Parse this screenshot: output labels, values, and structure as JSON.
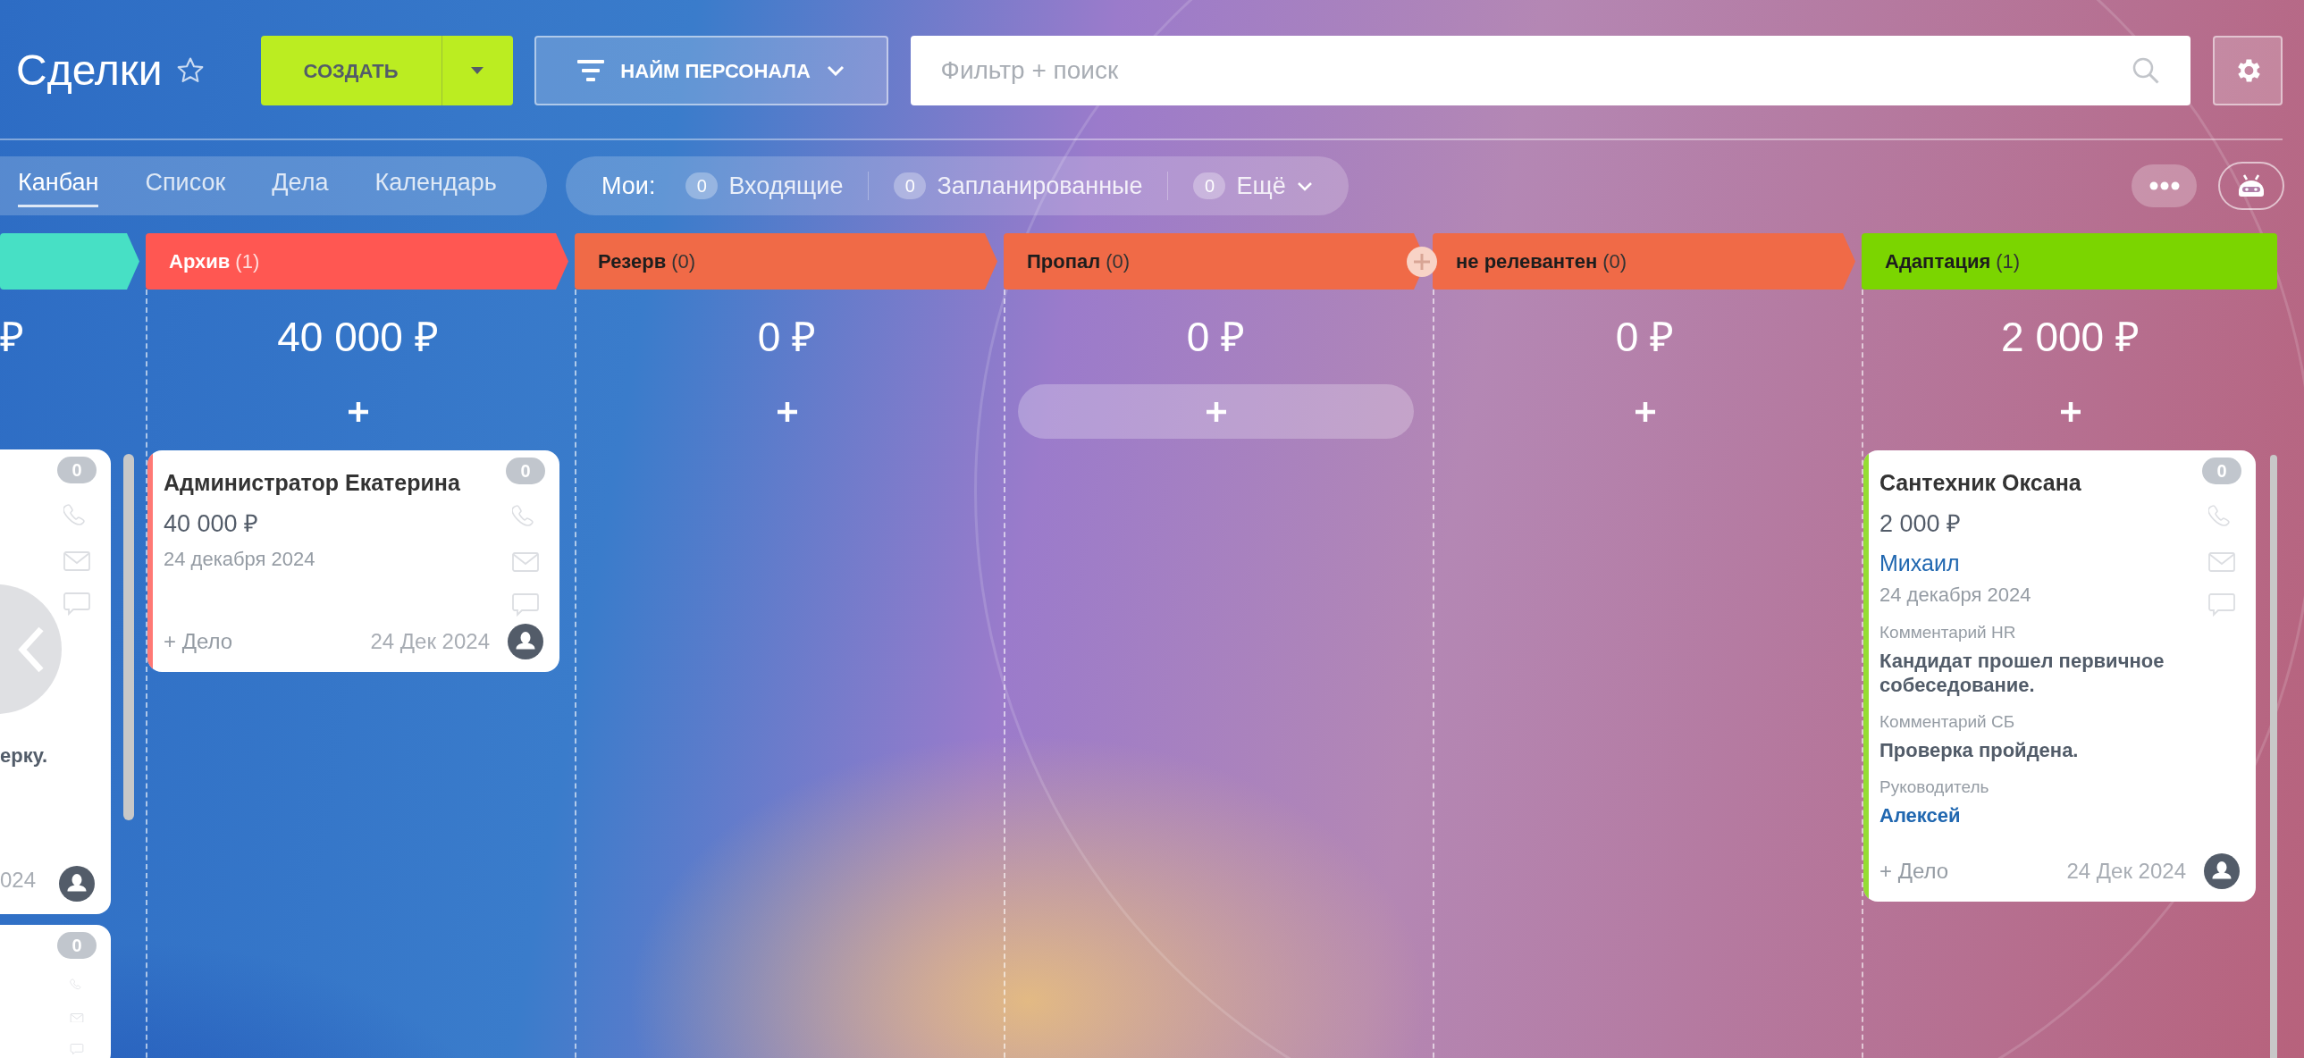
{
  "title": "Сделки",
  "create_button": {
    "label": "СОЗДАТЬ"
  },
  "category_button": {
    "label": "НАЙМ ПЕРСОНАЛА"
  },
  "search": {
    "placeholder": "Фильтр + поиск"
  },
  "view_tabs": [
    {
      "label": "Канбан",
      "selected": true
    },
    {
      "label": "Список",
      "selected": false
    },
    {
      "label": "Дела",
      "selected": false
    },
    {
      "label": "Календарь",
      "selected": false
    }
  ],
  "counters": {
    "label": "Мои:",
    "items": [
      {
        "count": "0",
        "label": "Входящие",
        "dropdown": false
      },
      {
        "count": "0",
        "label": "Запланированные",
        "dropdown": false
      },
      {
        "count": "0",
        "label": "Ещё",
        "dropdown": true
      }
    ]
  },
  "clipped_column": {
    "color": "#47e0c5",
    "amount": "₽",
    "cards": [
      {
        "counter": "0",
        "value_tail": "ерку.",
        "due_tail": "024"
      },
      {
        "counter": "0"
      }
    ]
  },
  "columns": [
    {
      "name": "Архив",
      "count": "(1)",
      "color": "#ff5752",
      "amount": "40 000 ₽",
      "add_highlighted": false,
      "cards": [
        {
          "title": "Администратор Екатерина",
          "amount": "40 000 ₽",
          "date": "24 декабря 2024",
          "counter": "0",
          "add_activity": "+ Дело",
          "due": "24 Дек 2024"
        }
      ]
    },
    {
      "name": "Резерв",
      "count": "(0)",
      "color": "#f06a47",
      "amount": "0 ₽",
      "add_highlighted": false
    },
    {
      "name": "Пропал",
      "count": "(0)",
      "color": "#f06a47",
      "amount": "0 ₽",
      "add_highlighted": true
    },
    {
      "name": "не релевантен",
      "count": "(0)",
      "color": "#f06a47",
      "amount": "0 ₽",
      "add_highlighted": false
    },
    {
      "name": "Адаптация",
      "count": "(1)",
      "color": "#7bd500",
      "amount": "2 000 ₽",
      "add_highlighted": false,
      "cards": [
        {
          "title": "Сантехник Оксана",
          "amount": "2 000 ₽",
          "contact": "Михаил",
          "date": "24 декабря 2024",
          "counter": "0",
          "add_activity": "+ Дело",
          "due": "24 Дек 2024",
          "fields": [
            {
              "label": "Комментарий HR",
              "value": "Кандидат прошел первичное собеседование.",
              "kind": "text"
            },
            {
              "label": "Комментарий СБ",
              "value": "Проверка пройдена.",
              "kind": "text"
            },
            {
              "label": "Руководитель",
              "value": "Алексей",
              "kind": "link"
            }
          ]
        }
      ]
    }
  ]
}
